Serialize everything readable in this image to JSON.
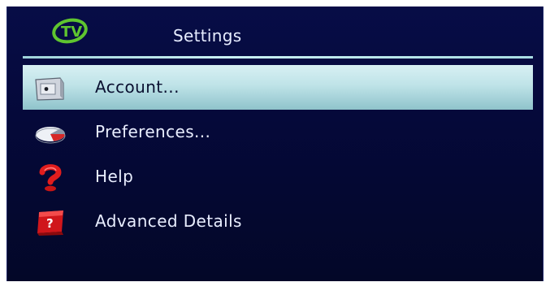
{
  "header": {
    "logo_text": "TV",
    "title": "Settings"
  },
  "menu": {
    "items": [
      {
        "label": "Account...",
        "icon": "account-icon",
        "selected": true
      },
      {
        "label": "Preferences...",
        "icon": "preferences-icon",
        "selected": false
      },
      {
        "label": "Help",
        "icon": "help-question-icon",
        "selected": false
      },
      {
        "label": "Advanced Details",
        "icon": "advanced-details-icon",
        "selected": false
      }
    ]
  },
  "colors": {
    "background": "#05093a",
    "selection": "#bfe3e8",
    "text": "#e9eeff",
    "logo": "#5fc52f"
  }
}
